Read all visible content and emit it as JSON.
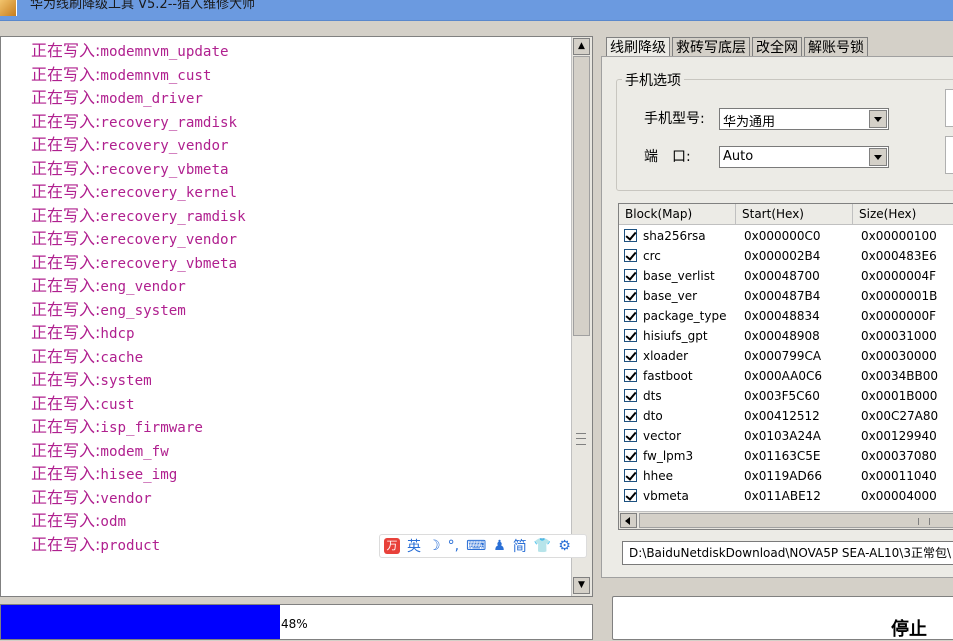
{
  "window": {
    "title": "华为线刷降级工具 V5.2--猎人维修大师"
  },
  "log": {
    "prefix": "正在写入:",
    "lines": [
      "modemnvm_update",
      "modemnvm_cust",
      "modem_driver",
      "recovery_ramdisk",
      "recovery_vendor",
      "recovery_vbmeta",
      "erecovery_kernel",
      "erecovery_ramdisk",
      "erecovery_vendor",
      "erecovery_vbmeta",
      "eng_vendor",
      "eng_system",
      "hdcp",
      "cache",
      "system",
      "cust",
      "isp_firmware",
      "modem_fw",
      "hisee_img",
      "vendor",
      "odm",
      "product"
    ]
  },
  "ime": {
    "logo": "万",
    "items": [
      "英",
      "☽",
      "°,",
      "⌨",
      "♟",
      "简",
      "👕",
      "⚙"
    ]
  },
  "progress": {
    "percent": 48,
    "text": "48%"
  },
  "tabs": [
    {
      "label": "线刷降级",
      "active": true
    },
    {
      "label": "救砖写底层",
      "active": false
    },
    {
      "label": "改全网",
      "active": false
    },
    {
      "label": "解账号锁",
      "active": false
    }
  ],
  "phone_options": {
    "group_title": "手机选项",
    "model_label": "手机型号:",
    "model_value": "华为通用",
    "port_label": "端　口:",
    "port_value": "Auto"
  },
  "block_table": {
    "headers": [
      "Block(Map)",
      "Start(Hex)",
      "Size(Hex)"
    ],
    "rows": [
      {
        "name": "sha256rsa",
        "start": "0x000000C0",
        "size": "0x00000100",
        "checked": true
      },
      {
        "name": "crc",
        "start": "0x000002B4",
        "size": "0x000483E6",
        "checked": true
      },
      {
        "name": "base_verlist",
        "start": "0x00048700",
        "size": "0x0000004F",
        "checked": true
      },
      {
        "name": "base_ver",
        "start": "0x000487B4",
        "size": "0x0000001B",
        "checked": true
      },
      {
        "name": "package_type",
        "start": "0x00048834",
        "size": "0x0000000F",
        "checked": true
      },
      {
        "name": "hisiufs_gpt",
        "start": "0x00048908",
        "size": "0x00031000",
        "checked": true
      },
      {
        "name": "xloader",
        "start": "0x000799CA",
        "size": "0x00030000",
        "checked": true
      },
      {
        "name": "fastboot",
        "start": "0x000AA0C6",
        "size": "0x0034BB00",
        "checked": true
      },
      {
        "name": "dts",
        "start": "0x003F5C60",
        "size": "0x0001B000",
        "checked": true
      },
      {
        "name": "dto",
        "start": "0x00412512",
        "size": "0x00C27A80",
        "checked": true
      },
      {
        "name": "vector",
        "start": "0x0103A24A",
        "size": "0x00129940",
        "checked": true
      },
      {
        "name": "fw_lpm3",
        "start": "0x01163C5E",
        "size": "0x00037080",
        "checked": true
      },
      {
        "name": "hhee",
        "start": "0x0119AD66",
        "size": "0x00011040",
        "checked": true
      },
      {
        "name": "vbmeta",
        "start": "0x011ABE12",
        "size": "0x00004000",
        "checked": true
      }
    ]
  },
  "path": {
    "value": "D:\\BaiduNetdiskDownload\\NOVA5P SEA-AL10\\3正常包\\"
  },
  "stop_button": {
    "label": "停止"
  }
}
